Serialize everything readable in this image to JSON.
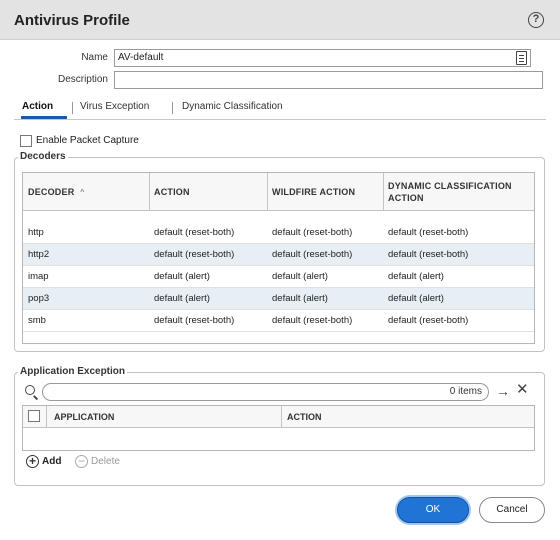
{
  "dialog": {
    "title": "Antivirus Profile",
    "help_icon": "help-icon",
    "help_glyph": "?"
  },
  "form": {
    "name_label": "Name",
    "name_value": "AV-default",
    "description_label": "Description",
    "description_value": ""
  },
  "tabs": [
    {
      "label": "Action",
      "active": true
    },
    {
      "label": "Virus Exception",
      "active": false
    },
    {
      "label": "Dynamic Classification",
      "active": false
    }
  ],
  "packet_capture": {
    "label": "Enable Packet Capture",
    "checked": false
  },
  "decoders": {
    "legend": "Decoders",
    "columns": [
      "DECODER",
      "ACTION",
      "WILDFIRE ACTION",
      "DYNAMIC CLASSIFICATION ACTION"
    ],
    "sort_glyph": "^",
    "rows": [
      {
        "decoder": "http",
        "action": "default (reset-both)",
        "wildfire": "default (reset-both)",
        "dynamic": "default (reset-both)"
      },
      {
        "decoder": "http2",
        "action": "default (reset-both)",
        "wildfire": "default (reset-both)",
        "dynamic": "default (reset-both)"
      },
      {
        "decoder": "imap",
        "action": "default (alert)",
        "wildfire": "default (alert)",
        "dynamic": "default (alert)"
      },
      {
        "decoder": "pop3",
        "action": "default (alert)",
        "wildfire": "default (alert)",
        "dynamic": "default (alert)"
      },
      {
        "decoder": "smb",
        "action": "default (reset-both)",
        "wildfire": "default (reset-both)",
        "dynamic": "default (reset-both)"
      }
    ]
  },
  "app_exception": {
    "legend": "Application Exception",
    "items_count": "0 items",
    "arrow_glyph": "→",
    "clear_glyph": "✕",
    "columns": [
      "APPLICATION",
      "ACTION"
    ],
    "add_label": "Add",
    "add_glyph": "+",
    "delete_label": "Delete",
    "delete_glyph": "−"
  },
  "footer": {
    "ok_label": "OK",
    "cancel_label": "Cancel"
  },
  "colors": {
    "accent": "#1f74d6",
    "row_highlight": "#e7eff5",
    "title_bar": "#e3e3e3"
  }
}
